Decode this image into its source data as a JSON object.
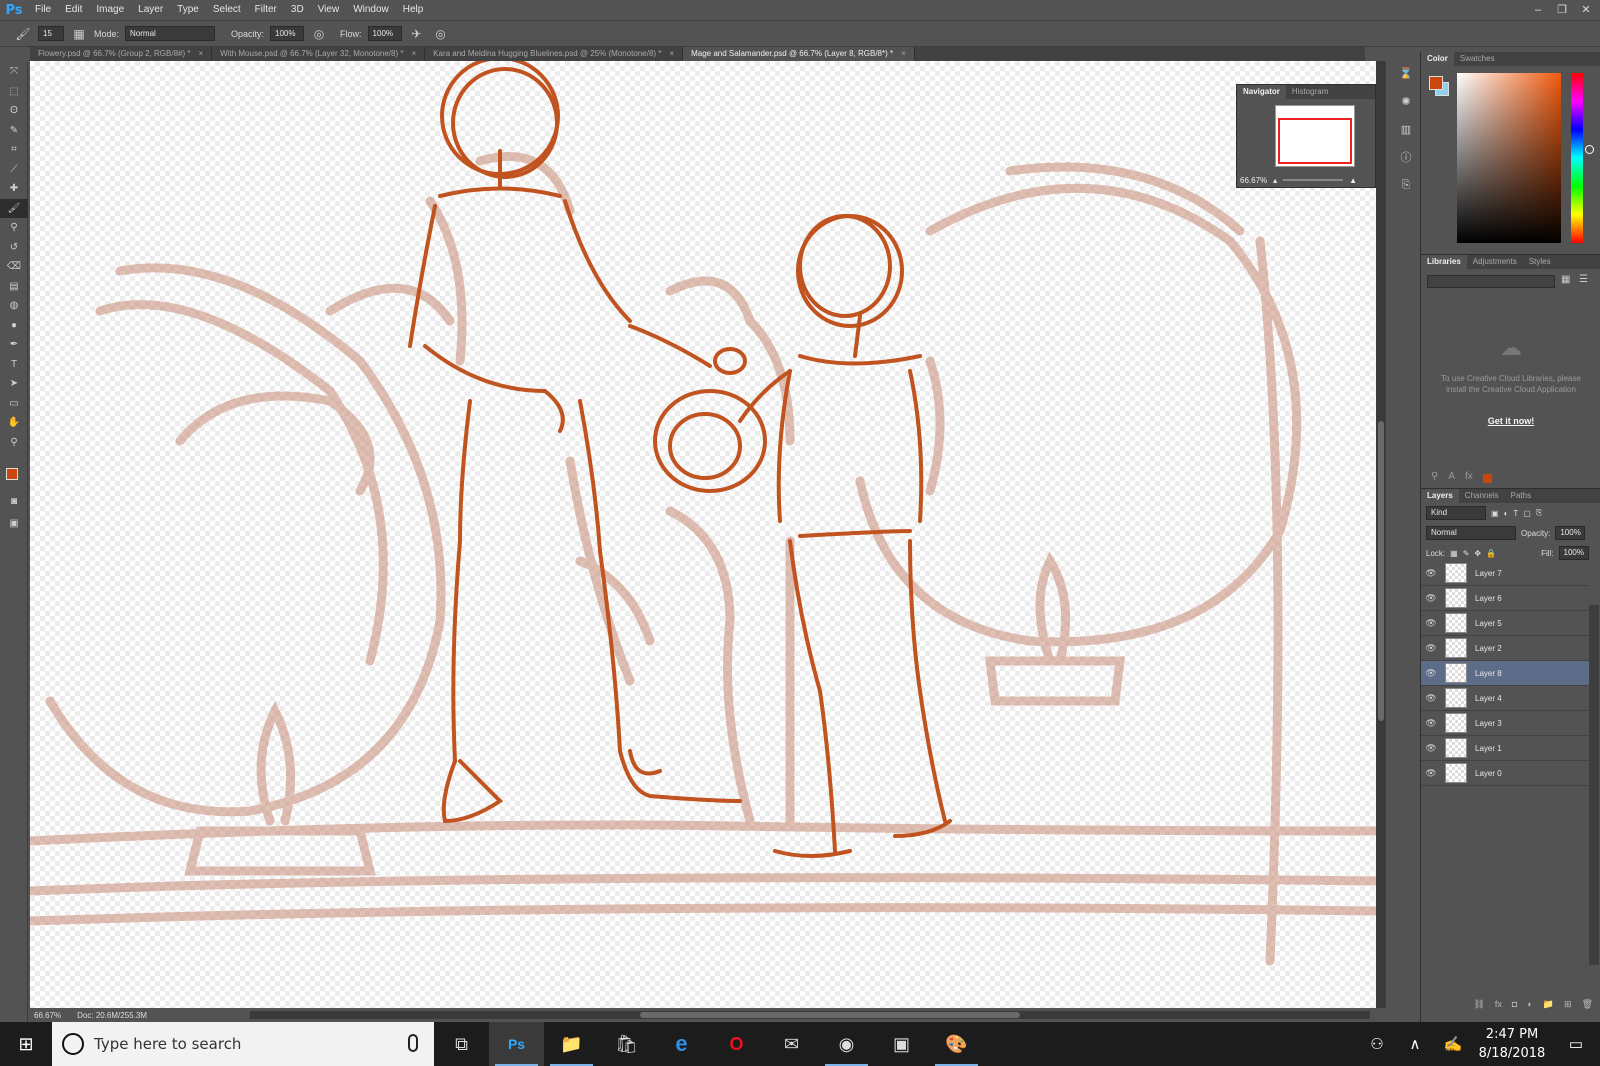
{
  "app": {
    "logo": "Ps"
  },
  "menu": [
    "File",
    "Edit",
    "Image",
    "Layer",
    "Type",
    "Select",
    "Filter",
    "3D",
    "View",
    "Window",
    "Help"
  ],
  "window_controls": {
    "minimize": "–",
    "restore": "❐",
    "close": "✕"
  },
  "options": {
    "brush_size": "15",
    "mode_label": "Mode:",
    "mode_value": "Normal",
    "opacity_label": "Opacity:",
    "opacity_value": "100%",
    "flow_label": "Flow:",
    "flow_value": "100%"
  },
  "doc_tabs": [
    {
      "label": "Flowery.psd @ 66.7% (Group 2, RGB/8#) *",
      "close": "×"
    },
    {
      "label": "With Mouse.psd @ 66.7% (Layer 32, Monotone/8) *",
      "close": "×"
    },
    {
      "label": "Kara and Meldina Hugging Bluelines.psd @ 25% (Monotone/8) *",
      "close": "×"
    },
    {
      "label": "Mage and Salamander.psd @ 66.7% (Layer 8, RGB/8*) *",
      "close": "×",
      "active": true
    }
  ],
  "tools": [
    "move-icon",
    "marquee-icon",
    "lasso-icon",
    "quick-select-icon",
    "crop-icon",
    "eyedropper-icon",
    "healing-brush-icon",
    "brush-icon",
    "clone-stamp-icon",
    "history-brush-icon",
    "eraser-icon",
    "gradient-icon",
    "blur-icon",
    "dodge-icon",
    "pen-icon",
    "type-icon",
    "path-select-icon",
    "rectangle-icon",
    "hand-icon",
    "zoom-icon"
  ],
  "tool_glyphs": [
    "⤧",
    "⬚",
    "ʘ",
    "✎",
    "⌗",
    "⟋",
    "✚",
    "🖌",
    "⚲",
    "↺",
    "⌫",
    "▤",
    "◍",
    "●",
    "✒",
    "T",
    "➤",
    "▭",
    "✋",
    "⚲"
  ],
  "active_tool_index": 7,
  "colors": {
    "foreground": "#c9460e",
    "background": "#8fd0ec",
    "sketch_dark": "#c0531f",
    "sketch_light": "#c98c77"
  },
  "status": {
    "zoom": "66.67%",
    "doc": "Doc: 20.6M/255.3M"
  },
  "navigator": {
    "tabs": [
      "Navigator",
      "Histogram"
    ],
    "zoom": "66.67%"
  },
  "color_panel": {
    "tabs": [
      "Color",
      "Swatches"
    ]
  },
  "libraries_panel": {
    "tabs": [
      "Libraries",
      "Adjustments",
      "Styles"
    ],
    "message": "To use Creative Cloud Libraries, please install the Creative Cloud Application",
    "link": "Get it now!"
  },
  "layers_panel": {
    "tabs": [
      "Layers",
      "Channels",
      "Paths"
    ],
    "filter": "Kind",
    "blend_mode": "Normal",
    "opacity_label": "Opacity:",
    "opacity_value": "100%",
    "lock_label": "Lock:",
    "fill_label": "Fill:",
    "fill_value": "100%",
    "layers": [
      {
        "name": "Layer 7",
        "selected": false
      },
      {
        "name": "Layer 6",
        "selected": false
      },
      {
        "name": "Layer 5",
        "selected": false
      },
      {
        "name": "Layer 2",
        "selected": false
      },
      {
        "name": "Layer 8",
        "selected": true
      },
      {
        "name": "Layer 4",
        "selected": false
      },
      {
        "name": "Layer 3",
        "selected": false
      },
      {
        "name": "Layer 1",
        "selected": false
      },
      {
        "name": "Layer 0",
        "selected": false
      }
    ]
  },
  "taskbar": {
    "search_placeholder": "Type here to search",
    "apps": [
      "task-view-icon",
      "photoshop-icon",
      "file-explorer-icon",
      "store-icon",
      "edge-icon",
      "opera-icon",
      "email-app-icon",
      "chrome-icon",
      "remote-desktop-icon",
      "paint-app-icon"
    ],
    "app_glyphs": [
      "⧉",
      "Ps",
      "📁",
      "🛍",
      "e",
      "O",
      "✉",
      "◉",
      "▣",
      "🎨"
    ],
    "time": "2:47 PM",
    "date": "8/18/2018"
  }
}
